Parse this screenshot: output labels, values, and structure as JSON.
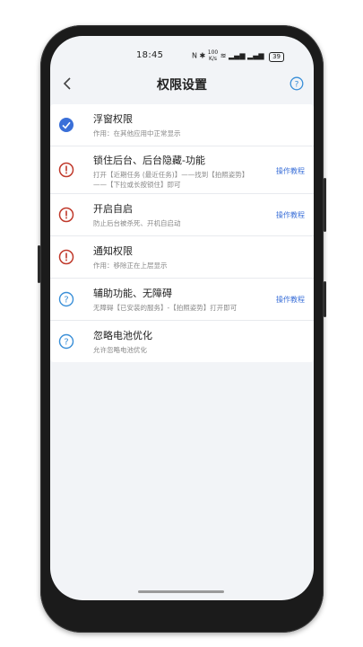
{
  "status": {
    "time": "18:45",
    "net_speed_top": "100",
    "net_speed_bottom": "K/s",
    "battery": "39"
  },
  "header": {
    "title": "权限设置"
  },
  "colors": {
    "accent": "#3a6fd8",
    "warning": "#c0392b",
    "check": "#3a6fd8",
    "info": "#3a8fd8"
  },
  "permissions": [
    {
      "icon": "check-circle-icon",
      "title": "浮窗权限",
      "desc": "作用：在其他应用中正常显示",
      "tutorial": ""
    },
    {
      "icon": "warning-circle-icon",
      "title": "锁住后台、后台隐藏-功能",
      "desc": "打开【近期任务 (最近任务)】——找到【拍照姿势】——【下拉或长按锁住】即可",
      "tutorial": "操作教程"
    },
    {
      "icon": "warning-circle-icon",
      "title": "开启自启",
      "desc": "防止后台被杀死、开机自启动",
      "tutorial": "操作教程"
    },
    {
      "icon": "warning-circle-icon",
      "title": "通知权限",
      "desc": "作用：移除正在上层显示",
      "tutorial": ""
    },
    {
      "icon": "question-circle-icon",
      "title": "辅助功能、无障碍",
      "desc": "无障碍【已安装的服务】-【拍照姿势】打开即可",
      "tutorial": "操作教程"
    },
    {
      "icon": "question-circle-icon",
      "title": "忽略电池优化",
      "desc": "允许忽略电池优化",
      "tutorial": ""
    }
  ]
}
